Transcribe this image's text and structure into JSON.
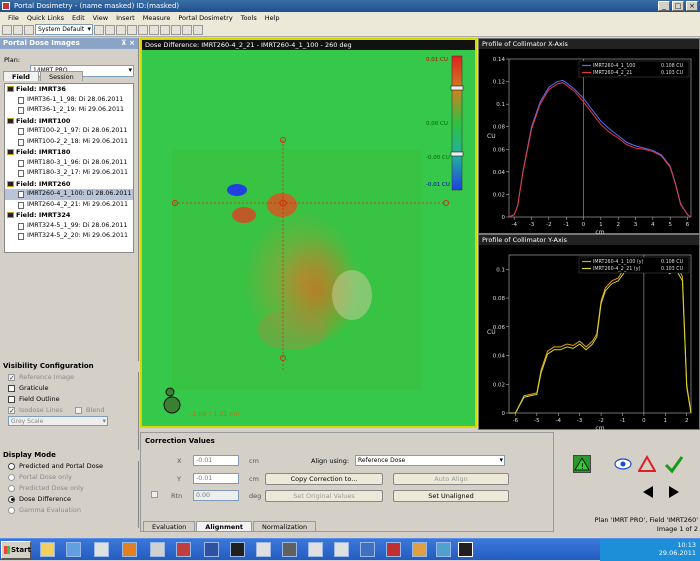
{
  "window": {
    "title": "Portal Dosimetry - (name masked) ID:(masked)"
  },
  "menu": [
    "File",
    "Quick Links",
    "Edit",
    "View",
    "Insert",
    "Measure",
    "Portal Dosimetry",
    "Tools",
    "Help"
  ],
  "toolbar": {
    "preset": "System Default"
  },
  "left": {
    "header": "Portal Dose Images",
    "plan_label": "Plan:",
    "plan_value": "1/IMRT PRO",
    "tabs": [
      "Field",
      "Session"
    ],
    "fields": [
      {
        "name": "Field: IMRT36",
        "images": [
          "IMRT36-1_1_98: Di 28.06.2011",
          "IMRT36-1_2_19: Mi 29.06.2011"
        ]
      },
      {
        "name": "Field: IMRT100",
        "images": [
          "IMRT100-2_1_97: Di 28.06.2011",
          "IMRT100-2_2_18: Mi 29.06.2011"
        ]
      },
      {
        "name": "Field: IMRT180",
        "images": [
          "IMRT180-3_1_96: Di 28.06.2011",
          "IMRT180-3_2_17: Mi 29.06.2011"
        ]
      },
      {
        "name": "Field: IMRT260",
        "images": [
          "IMRT260-4_1_100: Di 28.06.2011",
          "IMRT260-4_2_21: Mi 29.06.2011"
        ]
      },
      {
        "name": "Field: IMRT324",
        "images": [
          "IMRT324-5_1_99: Di 28.06.2011",
          "IMRT324-5_2_20: Mi 29.06.2011"
        ]
      }
    ],
    "selected_image": "IMRT260-4_1_100: Di 28.06.2011",
    "visibility": {
      "header": "Visibility Configuration",
      "reference_image": "Reference Image",
      "graticule": "Graticule",
      "field_outline": "Field Outline",
      "isodose_lines": "Isodose Lines",
      "blend": "Blend",
      "colormap": "Grey Scale"
    },
    "display": {
      "header": "Display Mode",
      "options": [
        "Predicted and Portal Dose",
        "Portal Dose only",
        "Predicted Dose only",
        "Dose Difference",
        "Gamma Evaluation"
      ],
      "selected": "Dose Difference"
    }
  },
  "image": {
    "title": "Dose Difference: IMRT260-4_2_21 - IMRT260-4_1_100 - 260 deg",
    "colorbar_labels": [
      "0.01 CU",
      "0.00 CU",
      "-0.00 CU",
      "-0.01 CU"
    ],
    "cursor_readout": "-1.68 / 1.21 cm"
  },
  "chart_x": {
    "title": "Profile of Collimator X-Axis",
    "legend": [
      "IMRT260-4_1_100",
      "IMRT260-4_2_21"
    ],
    "legend_values": [
      "0.108 CU",
      "0.103 CU"
    ],
    "ylabel": "CU",
    "xlabel": "cm",
    "yticks": [
      "0.14",
      "0.12",
      "0.1",
      "0.08",
      "0.06",
      "0.04",
      "0.02",
      "0"
    ],
    "xticks": [
      "-4",
      "-3",
      "-2",
      "-1",
      "0",
      "1",
      "2",
      "3",
      "4",
      "5",
      "6"
    ]
  },
  "chart_y": {
    "title": "Profile of Collimator Y-Axis",
    "legend": [
      "IMRT260-4_1_100 (y)",
      "IMRT260-4_2_21 (y)"
    ],
    "legend_values": [
      "0.108 CU",
      "0.103 CU"
    ],
    "ylabel": "CU",
    "xlabel": "cm",
    "yticks": [
      "0.1",
      "0.08",
      "0.06",
      "0.04",
      "0.02",
      "0"
    ],
    "xticks": [
      "-6",
      "-5",
      "-4",
      "-3",
      "-2",
      "-1",
      "0",
      "1",
      "2"
    ]
  },
  "chart_data": [
    {
      "type": "line",
      "title": "Profile of Collimator X-Axis",
      "xlabel": "cm",
      "ylabel": "CU",
      "xlim": [
        -4.3,
        6.2
      ],
      "ylim": [
        0,
        0.14
      ],
      "x": [
        -4.3,
        -4,
        -3.8,
        -3.5,
        -3,
        -2.5,
        -2,
        -1.5,
        -1.2,
        -1,
        -0.5,
        0,
        0.5,
        1,
        1.5,
        2,
        2.5,
        3,
        3.5,
        4,
        4.5,
        5,
        5.3,
        5.6,
        6,
        6.2
      ],
      "series": [
        {
          "name": "IMRT260-4_1_100",
          "color": "#5a6cff",
          "values": [
            0,
            0.002,
            0.01,
            0.04,
            0.08,
            0.102,
            0.115,
            0.12,
            0.121,
            0.119,
            0.113,
            0.105,
            0.095,
            0.085,
            0.078,
            0.072,
            0.066,
            0.063,
            0.061,
            0.059,
            0.055,
            0.045,
            0.03,
            0.012,
            0.002,
            0
          ]
        },
        {
          "name": "IMRT260-4_2_21",
          "color": "#e63a3a",
          "values": [
            0,
            0.002,
            0.01,
            0.039,
            0.078,
            0.1,
            0.113,
            0.118,
            0.119,
            0.117,
            0.111,
            0.102,
            0.092,
            0.082,
            0.075,
            0.07,
            0.064,
            0.061,
            0.06,
            0.058,
            0.054,
            0.044,
            0.029,
            0.011,
            0.002,
            0
          ]
        }
      ]
    },
    {
      "type": "line",
      "title": "Profile of Collimator Y-Axis",
      "xlabel": "cm",
      "ylabel": "CU",
      "xlim": [
        -6.3,
        2.2
      ],
      "ylim": [
        0,
        0.11
      ],
      "x": [
        -6.3,
        -6,
        -5.6,
        -5.3,
        -5,
        -4.8,
        -4.5,
        -4.2,
        -3.9,
        -3.6,
        -3.3,
        -3,
        -2.7,
        -2.4,
        -2.2,
        -2,
        -1.8,
        -1.5,
        -1.2,
        -0.9,
        -0.6,
        -0.3,
        0,
        0.3,
        0.6,
        0.9,
        1.2,
        1.5,
        1.8,
        2,
        2.2
      ],
      "series": [
        {
          "name": "IMRT260-4_1_100 (y)",
          "color": "#e8a020",
          "values": [
            0,
            0,
            0.012,
            0.013,
            0.014,
            0.03,
            0.043,
            0.046,
            0.046,
            0.048,
            0.047,
            0.05,
            0.046,
            0.05,
            0.055,
            0.078,
            0.087,
            0.092,
            0.094,
            0.101,
            0.106,
            0.104,
            0.104,
            0.108,
            0.103,
            0.106,
            0.101,
            0.104,
            0.095,
            0.02,
            0
          ]
        },
        {
          "name": "IMRT260-4_2_21 (y)",
          "color": "#d8d820",
          "values": [
            0,
            0,
            0.011,
            0.012,
            0.013,
            0.028,
            0.041,
            0.044,
            0.044,
            0.046,
            0.045,
            0.048,
            0.044,
            0.048,
            0.053,
            0.076,
            0.085,
            0.09,
            0.092,
            0.098,
            0.103,
            0.101,
            0.1,
            0.103,
            0.099,
            0.102,
            0.097,
            0.1,
            0.092,
            0.018,
            0
          ]
        }
      ]
    }
  ],
  "correction": {
    "header": "Correction Values",
    "x_label": "X",
    "x_value": "-0.01",
    "x_unit": "cm",
    "y_label": "Y",
    "y_value": "-0.01",
    "y_unit": "cm",
    "rtn_label": "Rtn",
    "rtn_value": "0.00",
    "rtn_unit": "deg",
    "align_label": "Align using:",
    "align_value": "Reference Dose",
    "copy_btn": "Copy Correction to...",
    "auto_align_btn": "Auto Align",
    "set_original_btn": "Set Original Values",
    "set_unaligned_btn": "Set Unaligned",
    "tabs": [
      "Evaluation",
      "Alignment",
      "Normalization"
    ]
  },
  "status": {
    "plan_field": "Plan 'IMRT PRO', Field 'IMRT260'",
    "image_count": "Image 1 of 2"
  },
  "taskbar": {
    "start": "Start",
    "time": "10:13",
    "date": "29.06.2011"
  }
}
